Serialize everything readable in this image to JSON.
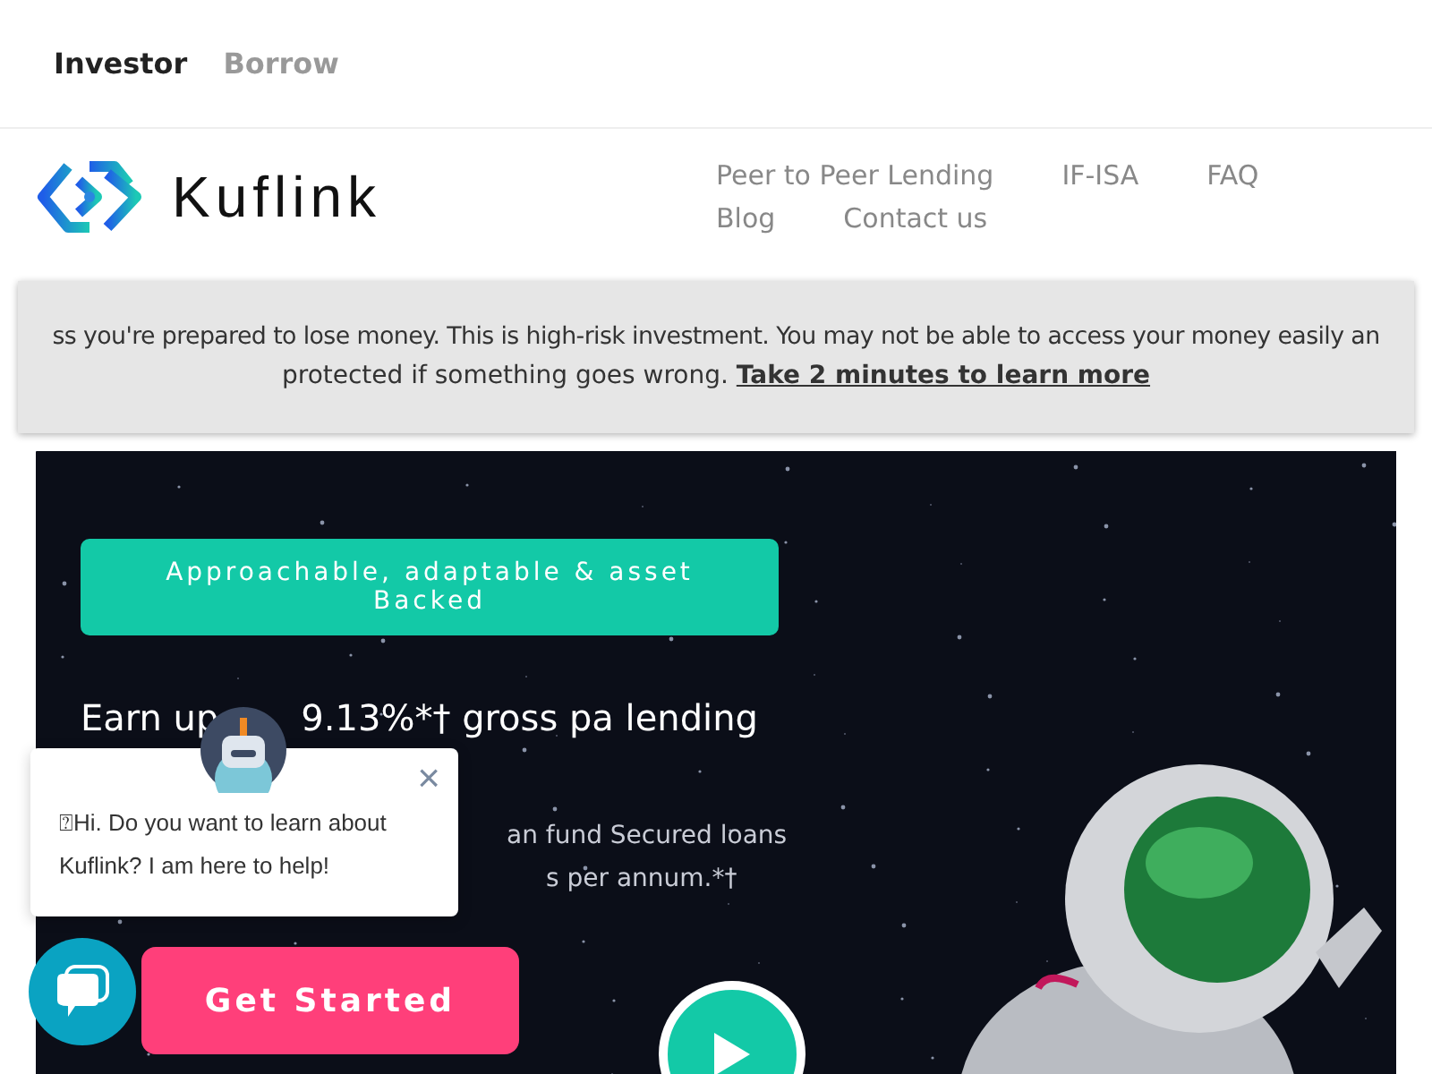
{
  "top_tabs": [
    {
      "label": "Investor",
      "selected": true
    },
    {
      "label": "Borrow",
      "selected": false
    }
  ],
  "header": {
    "logo_text": "Kuflink",
    "nav_links": [
      "Peer to Peer Lending",
      "IF-ISA",
      "FAQ",
      "Blog",
      "Contact us"
    ]
  },
  "risk_banner": {
    "line_1": "ss you're prepared to lose money. This is high-risk investment. You may not be able to access your money easily an",
    "line_2": "protected if something goes wrong.",
    "link": "Take 2 minutes to learn more"
  },
  "hero": {
    "tag": "Approachable, adaptable & asset Backed",
    "title_start": "Earn up",
    "title_end": "9.13%*† gross pa lending",
    "body_line_1": "an fund Secured loans",
    "body_line_2": "s per annum.*†",
    "cta": "Get Started"
  },
  "chat_popup": {
    "message": "⍰Hi. Do you want to learn about Kuflink? I am here to help!",
    "close": "×"
  }
}
